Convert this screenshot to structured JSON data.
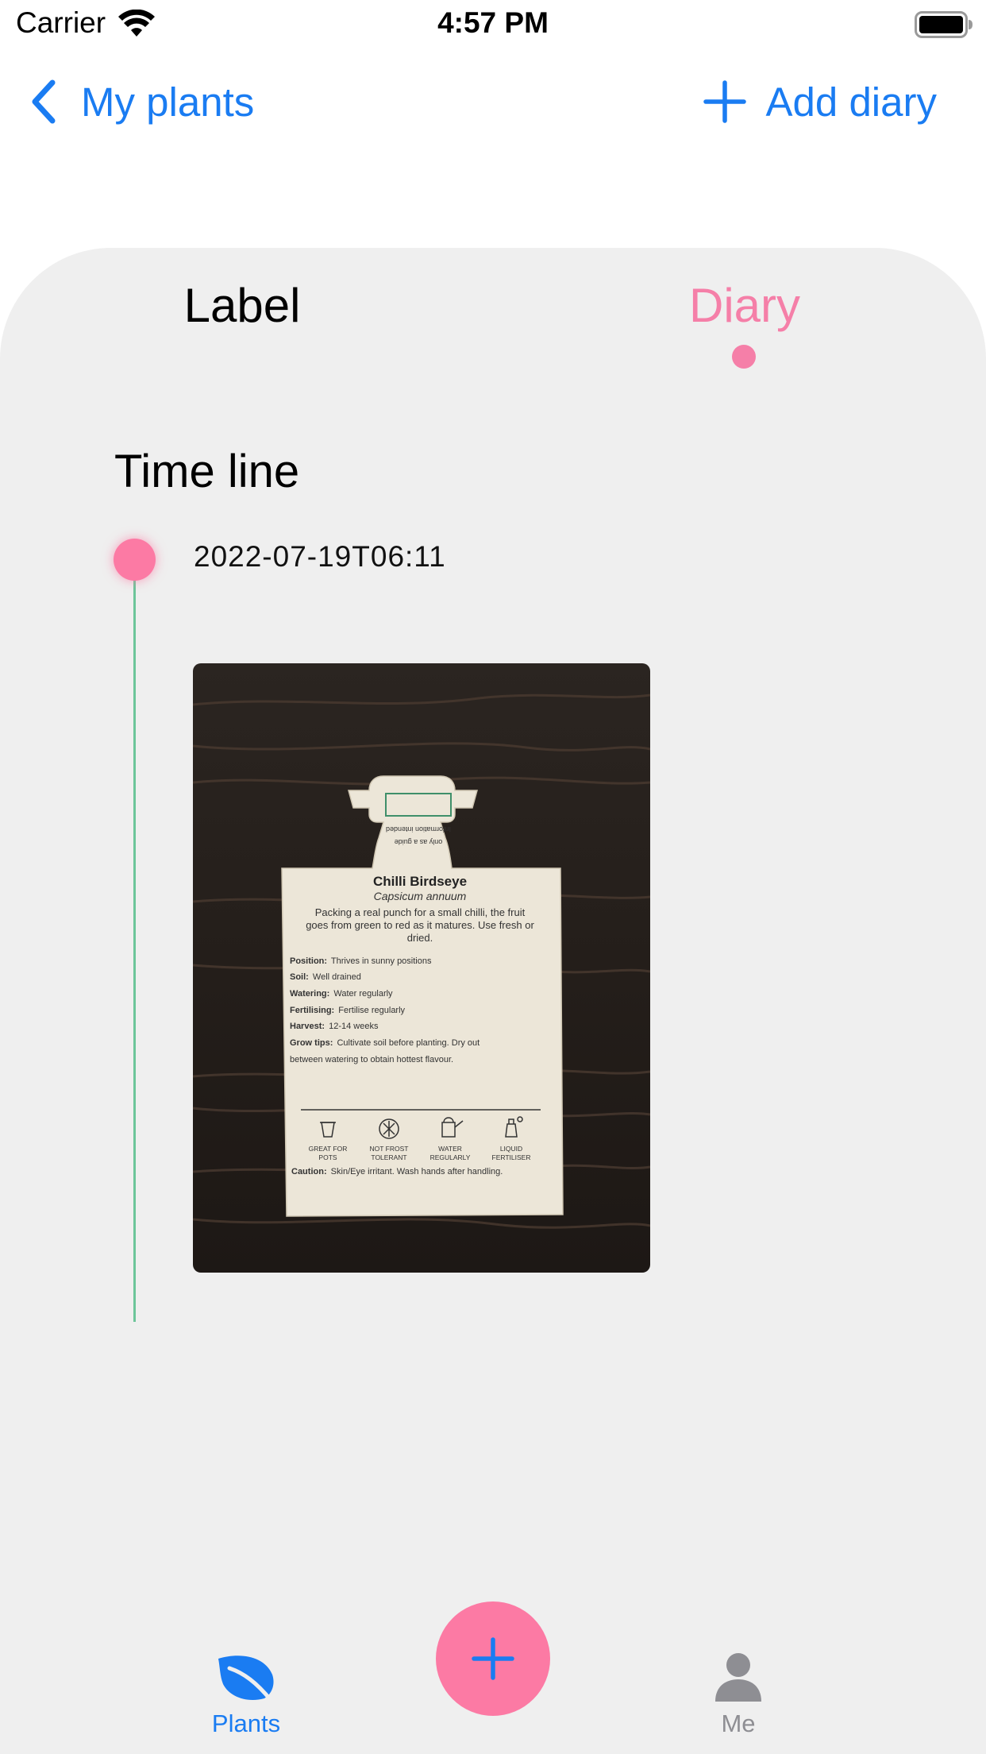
{
  "status_bar": {
    "carrier": "Carrier",
    "time": "4:57 PM",
    "wifi_icon": "wifi-icon",
    "battery_icon": "battery-icon"
  },
  "nav": {
    "back_label": "My plants",
    "back_icon": "chevron-left-icon",
    "add_label": "Add diary",
    "add_icon": "plus-icon"
  },
  "tabs": [
    {
      "label": "Label",
      "selected": false
    },
    {
      "label": "Diary",
      "selected": true
    }
  ],
  "timeline": {
    "title": "Time line",
    "entries": [
      {
        "date": "2022-07-19T06:11",
        "photo": {
          "label": {
            "stub_top": "Information intended",
            "stub_bottom": "only as a guide",
            "title": "Chilli Birdseye",
            "subtitle": "Capsicum annuum",
            "description": "Packing a real punch for a small chilli, the fruit goes from green to red as it matures. Use fresh or dried.",
            "description_lines": [
              "Packing a real punch for a small chilli, the fruit",
              "goes from green to red as it matures. Use fresh or",
              "dried."
            ],
            "care": [
              {
                "key": "Position:",
                "value": "Thrives in sunny positions"
              },
              {
                "key": "Soil:",
                "value": "Well drained"
              },
              {
                "key": "Watering:",
                "value": "Water regularly"
              },
              {
                "key": "Fertilising:",
                "value": "Fertilise regularly"
              },
              {
                "key": "Harvest:",
                "value": "12-14 weeks"
              },
              {
                "key": "Grow tips:",
                "value": "Cultivate soil before planting. Dry out"
              }
            ],
            "grow_tips_cont": "between watering to obtain hottest flavour.",
            "icons": [
              {
                "l1": "GREAT FOR",
                "l2": "POTS",
                "icon": "pot-icon"
              },
              {
                "l1": "NOT FROST",
                "l2": "TOLERANT",
                "icon": "frost-icon"
              },
              {
                "l1": "WATER",
                "l2": "REGULARLY",
                "icon": "watering-can-icon"
              },
              {
                "l1": "LIQUID",
                "l2": "FERTILISER",
                "icon": "fertiliser-icon"
              }
            ],
            "caution_key": "Caution:",
            "caution_value": "Skin/Eye irritant. Wash hands after handling."
          }
        }
      }
    ]
  },
  "tabbar": {
    "plants_label": "Plants",
    "plants_icon": "leaf-icon",
    "add_icon": "plus-icon",
    "me_label": "Me",
    "me_icon": "person-icon"
  },
  "colors": {
    "accent_blue": "#1a7cf2",
    "accent_pink": "#f57fa8",
    "fab_pink": "#fc7aa4",
    "timeline_green": "#6cc59a",
    "card_bg": "#efefef",
    "inactive_gray": "#8e8e93"
  }
}
